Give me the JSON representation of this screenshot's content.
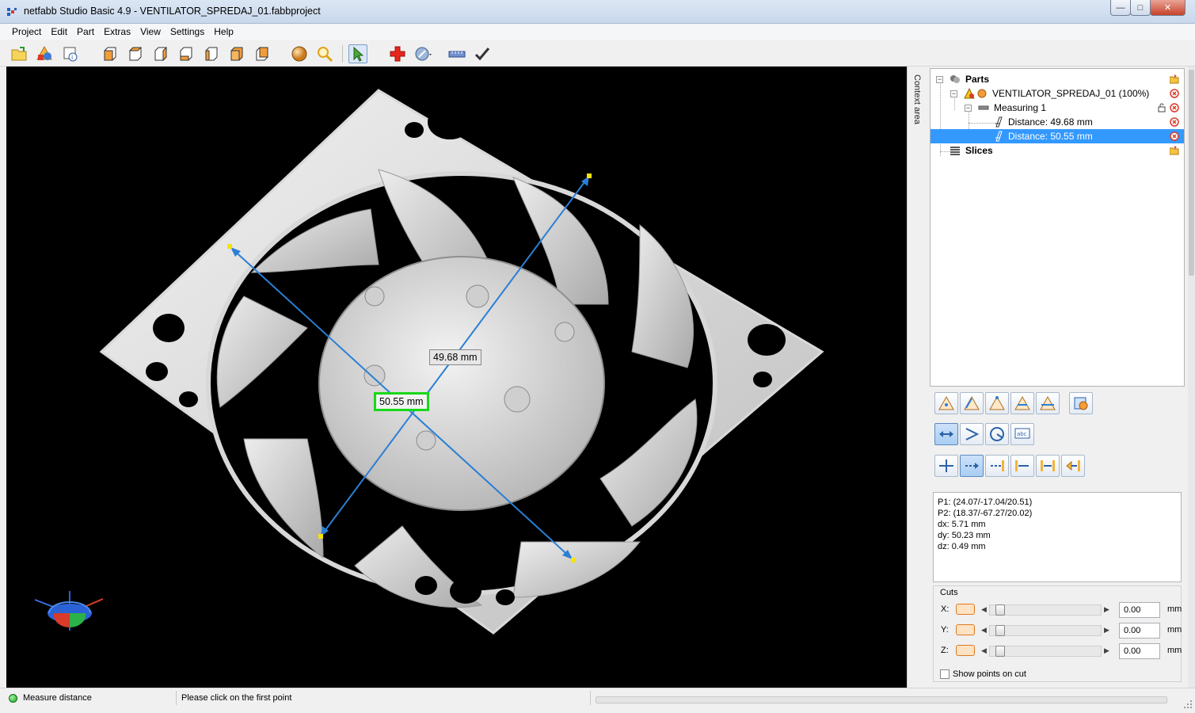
{
  "window": {
    "title": "netfabb Studio Basic 4.9 - VENTILATOR_SPREDAJ_01.fabbproject"
  },
  "menu": {
    "items": [
      {
        "label": "Project"
      },
      {
        "label": "Edit"
      },
      {
        "label": "Part"
      },
      {
        "label": "Extras"
      },
      {
        "label": "View"
      },
      {
        "label": "Settings"
      },
      {
        "label": "Help"
      }
    ]
  },
  "toolbar": {
    "icons": [
      "open-project-icon",
      "add-part-icon",
      "part-info-icon",
      "view-front-icon",
      "view-back-icon",
      "view-left-icon",
      "view-right-icon",
      "view-top-icon",
      "view-bottom-icon",
      "view-iso-icon",
      "shading-sphere-icon",
      "zoom-icon",
      "select-pointer-icon",
      "repair-cross-icon",
      "measure-dropdown-icon",
      "ruler-icon",
      "apply-check-icon"
    ]
  },
  "viewport": {
    "labels": {
      "distance_a": "49.68 mm",
      "distance_b": "50.55 mm"
    }
  },
  "context_area": {
    "label": "Context area"
  },
  "tree": {
    "parts_label": "Parts",
    "part_name": "VENTILATOR_SPREDAJ_01 (100%)",
    "measuring_label": "Measuring 1",
    "distance_1": "Distance: 49.68 mm",
    "distance_2": "Distance: 50.55 mm",
    "slices_label": "Slices"
  },
  "info": {
    "p1": "P1: (24.07/-17.04/20.51)",
    "p2": "P2: (18.37/-67.27/20.02)",
    "dx": "dx: 5.71 mm",
    "dy": "dy: 50.23 mm",
    "dz": "dz: 0.49 mm"
  },
  "cuts": {
    "title": "Cuts",
    "rows": [
      {
        "axis": "X:",
        "value": "0.00",
        "unit": "mm"
      },
      {
        "axis": "Y:",
        "value": "0.00",
        "unit": "mm"
      },
      {
        "axis": "Z:",
        "value": "0.00",
        "unit": "mm"
      }
    ],
    "show_points_label": "Show points on cut"
  },
  "status": {
    "mode": "Measure distance",
    "message": "Please click on the first point"
  },
  "colors": {
    "measure_line": "#2a7fd4",
    "selected_label_border": "#18d818",
    "selection_highlight": "#3399ff",
    "status_led": "#1ca41c"
  }
}
